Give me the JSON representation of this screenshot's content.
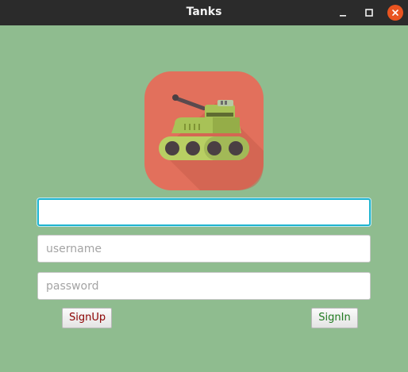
{
  "window": {
    "title": "Tanks"
  },
  "logo": {
    "icon": "tank-app-icon",
    "colors": {
      "background": "#e2705c",
      "tank_body": "#a8c257",
      "wheels": "#4a3f43"
    }
  },
  "form": {
    "first_field": {
      "value": "",
      "placeholder": ""
    },
    "username": {
      "value": "",
      "placeholder": "username"
    },
    "password": {
      "value": "",
      "placeholder": "password"
    }
  },
  "buttons": {
    "signup_label": "SignUp",
    "signin_label": "SignIn"
  },
  "colors": {
    "window_background": "#8fbc8f",
    "titlebar": "#2b2b2b",
    "close_button": "#e95420",
    "focus_ring": "#1fb4cf",
    "signup_text": "#8b0000",
    "signin_text": "#1f7a1f"
  }
}
